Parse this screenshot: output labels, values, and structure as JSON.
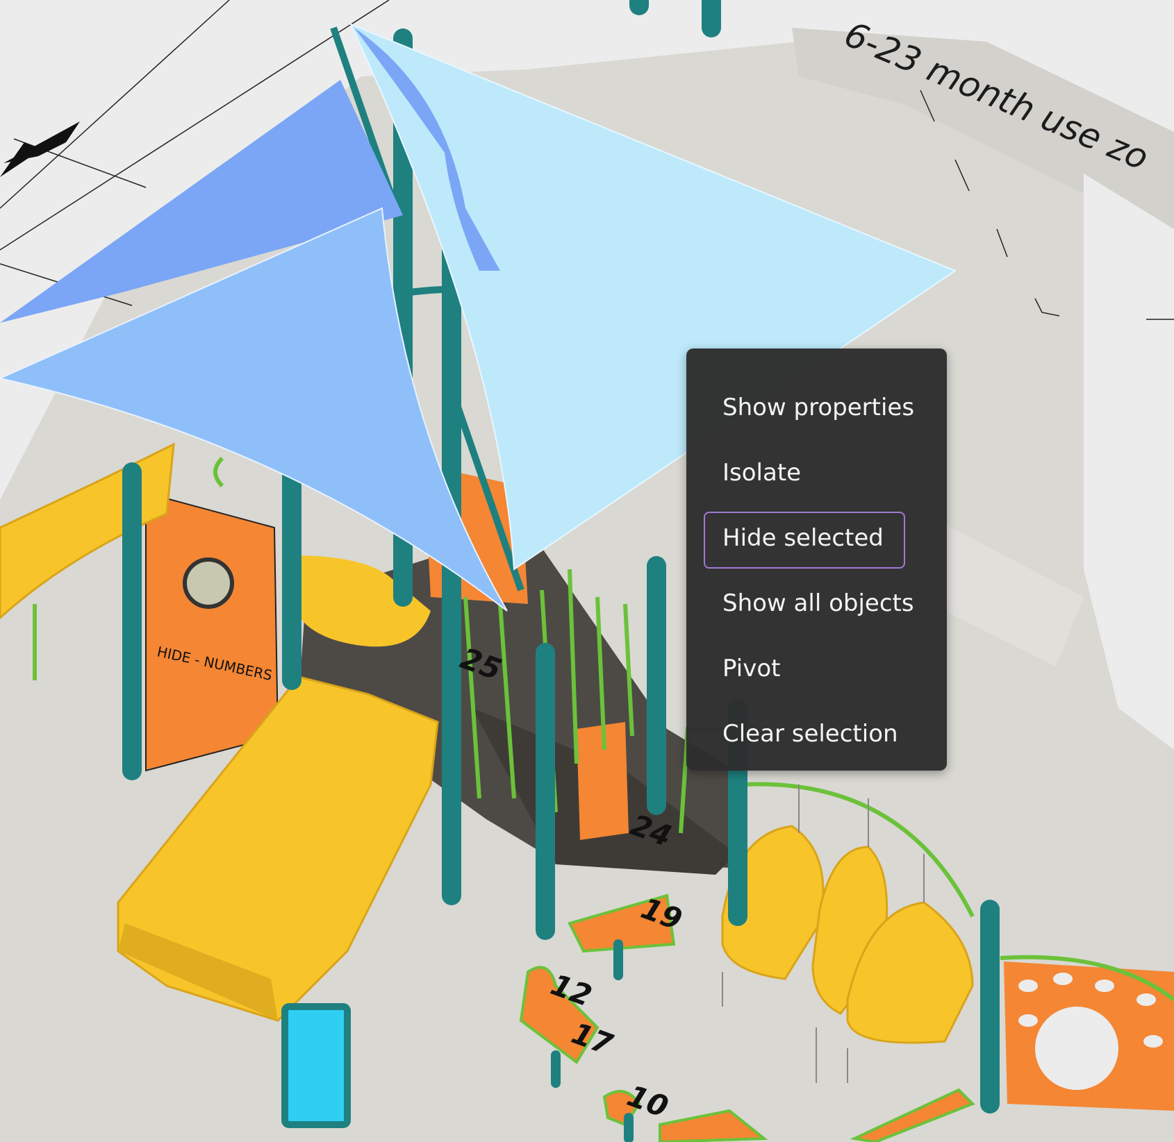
{
  "viewport": {
    "zone_label": "6-23 month use zo",
    "step_numbers": [
      "25",
      "24",
      "19",
      "12",
      "17",
      "10"
    ],
    "panel_text": "HIDE - NUMBERS"
  },
  "context_menu": {
    "items": [
      {
        "label": "Show properties",
        "hovered": false
      },
      {
        "label": "Isolate",
        "hovered": false
      },
      {
        "label": "Hide selected",
        "hovered": true
      },
      {
        "label": "Show all objects",
        "hovered": false
      },
      {
        "label": "Pivot",
        "hovered": false
      },
      {
        "label": "Clear selection",
        "hovered": false
      }
    ]
  },
  "colors": {
    "background": "#ececec",
    "ground": "#d9d8d3",
    "canopy_dark": "#7aa6f5",
    "canopy_mid": "#8fbff9",
    "canopy_light": "#bde9fb",
    "post_teal": "#1f8080",
    "slide_yellow": "#f7c52a",
    "panel_orange": "#f48634",
    "rail_green": "#6bc23a",
    "deck_gray": "#4d4a45",
    "menu_bg": "#2d2d2d",
    "menu_text": "#f4f4f4",
    "hover_outline": "#a279d6"
  }
}
